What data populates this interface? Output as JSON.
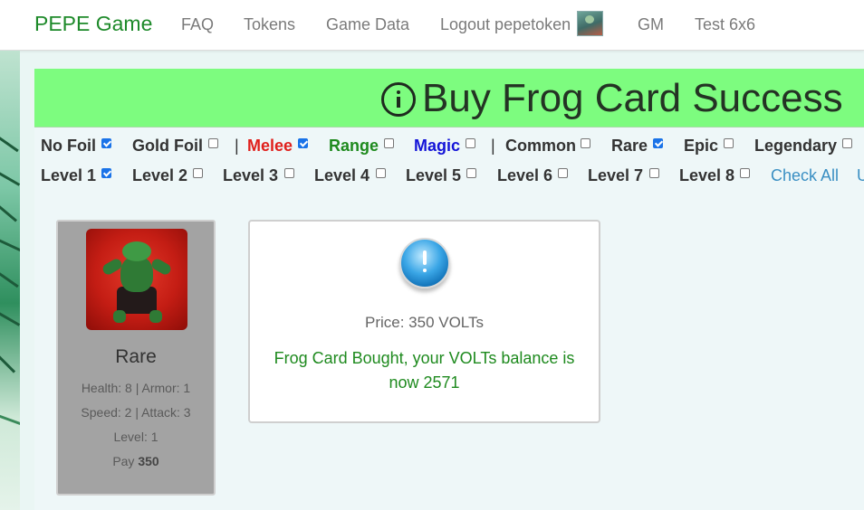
{
  "navbar": {
    "brand": "PEPE Game",
    "links": [
      "FAQ",
      "Tokens",
      "Game Data",
      "Logout pepetoken",
      "GM",
      "Test 6x6"
    ]
  },
  "banner": {
    "title": "Buy Frog Card Success",
    "color": "#7dfc7f"
  },
  "filters": {
    "row1": [
      {
        "label": "No Foil",
        "checked": true,
        "color": "#333333"
      },
      {
        "label": "Gold Foil",
        "checked": false,
        "color": "#333333"
      },
      {
        "label": "Melee",
        "checked": true,
        "color": "#e0201c"
      },
      {
        "label": "Range",
        "checked": false,
        "color": "#1e8a1e"
      },
      {
        "label": "Magic",
        "checked": false,
        "color": "#1414d8"
      },
      {
        "label": "Common",
        "checked": false,
        "color": "#333333"
      },
      {
        "label": "Rare",
        "checked": true,
        "color": "#333333"
      },
      {
        "label": "Epic",
        "checked": false,
        "color": "#333333"
      },
      {
        "label": "Legendary",
        "checked": false,
        "color": "#333333"
      }
    ],
    "separator": "|",
    "row2": [
      {
        "label": "Level 1",
        "checked": true
      },
      {
        "label": "Level 2",
        "checked": false
      },
      {
        "label": "Level 3",
        "checked": false
      },
      {
        "label": "Level 4",
        "checked": false
      },
      {
        "label": "Level 5",
        "checked": false
      },
      {
        "label": "Level 6",
        "checked": false
      },
      {
        "label": "Level 7",
        "checked": false
      },
      {
        "label": "Level 8",
        "checked": false
      }
    ],
    "check_all": "Check All",
    "uncheck_partial": "U"
  },
  "card": {
    "rarity": "Rare",
    "line1": "Health: 8 | Armor: 1",
    "line2": "Speed: 2 | Attack: 3",
    "line3": "Level: 1",
    "pay_label": "Pay",
    "pay_value": "350"
  },
  "result": {
    "price": "Price: 350 VOLTs",
    "message": "Frog Card Bought, your VOLTs balance is now 2571"
  }
}
